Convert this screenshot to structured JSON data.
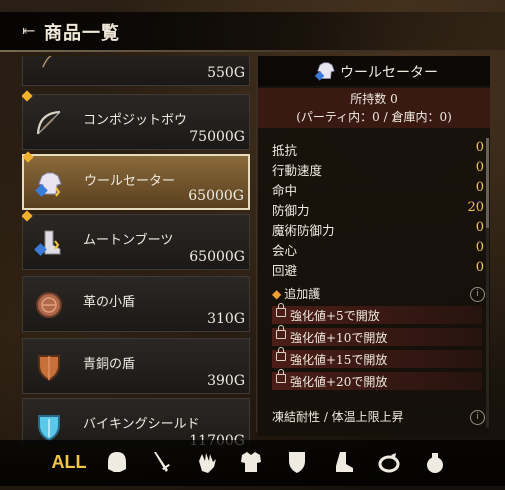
{
  "header": {
    "back_icon": "back-arrow-icon",
    "title": "商品一覧"
  },
  "items": [
    {
      "name": "",
      "price": "550G",
      "icon": "bow-icon",
      "selected": false,
      "new": false
    },
    {
      "name": "コンポジットボウ",
      "price": "75000G",
      "icon": "bow-icon",
      "selected": false,
      "new": true
    },
    {
      "name": "ウールセーター",
      "price": "65000G",
      "icon": "sweater-icon",
      "selected": true,
      "new": true
    },
    {
      "name": "ムートンブーツ",
      "price": "65000G",
      "icon": "boots-icon",
      "selected": false,
      "new": true
    },
    {
      "name": "革の小盾",
      "price": "310G",
      "icon": "round-shield-icon",
      "selected": false,
      "new": false
    },
    {
      "name": "青銅の盾",
      "price": "390G",
      "icon": "bronze-shield-icon",
      "selected": false,
      "new": false
    },
    {
      "name": "バイキングシールド",
      "price": "11700G",
      "icon": "viking-shield-icon",
      "selected": false,
      "new": false
    }
  ],
  "detail": {
    "name": "ウールセーター",
    "owned_line": "所持数 0",
    "owned_breakdown": "(パーティ内：0 / 倉庫内：0)",
    "stats": [
      {
        "label": "抵抗",
        "value": "0"
      },
      {
        "label": "行動速度",
        "value": "0"
      },
      {
        "label": "命中",
        "value": "0"
      },
      {
        "label": "防御力",
        "value": "20"
      },
      {
        "label": "魔術防御力",
        "value": "0"
      },
      {
        "label": "会心",
        "value": "0"
      },
      {
        "label": "回避",
        "value": "0"
      }
    ],
    "additional_label": "追加護",
    "unlocks": [
      "強化値+5で開放",
      "強化値+10で開放",
      "強化値+15で開放",
      "強化値+20で開放"
    ],
    "resist": "凍結耐性 / 体温上限上昇",
    "info_glyph": "i"
  },
  "categories": [
    {
      "label": "ALL",
      "icon": "all-text",
      "active": true
    },
    {
      "label": "",
      "icon": "head-icon"
    },
    {
      "label": "",
      "icon": "weapon-icon"
    },
    {
      "label": "",
      "icon": "hand-icon"
    },
    {
      "label": "",
      "icon": "armor-icon"
    },
    {
      "label": "",
      "icon": "shield-icon"
    },
    {
      "label": "",
      "icon": "boot-icon"
    },
    {
      "label": "",
      "icon": "ring-icon"
    },
    {
      "label": "",
      "icon": "item-bag-icon"
    }
  ],
  "colors": {
    "accent": "#f3c64a",
    "selected_bg": "#8a6a3a",
    "unlock_bg": "#782823"
  }
}
